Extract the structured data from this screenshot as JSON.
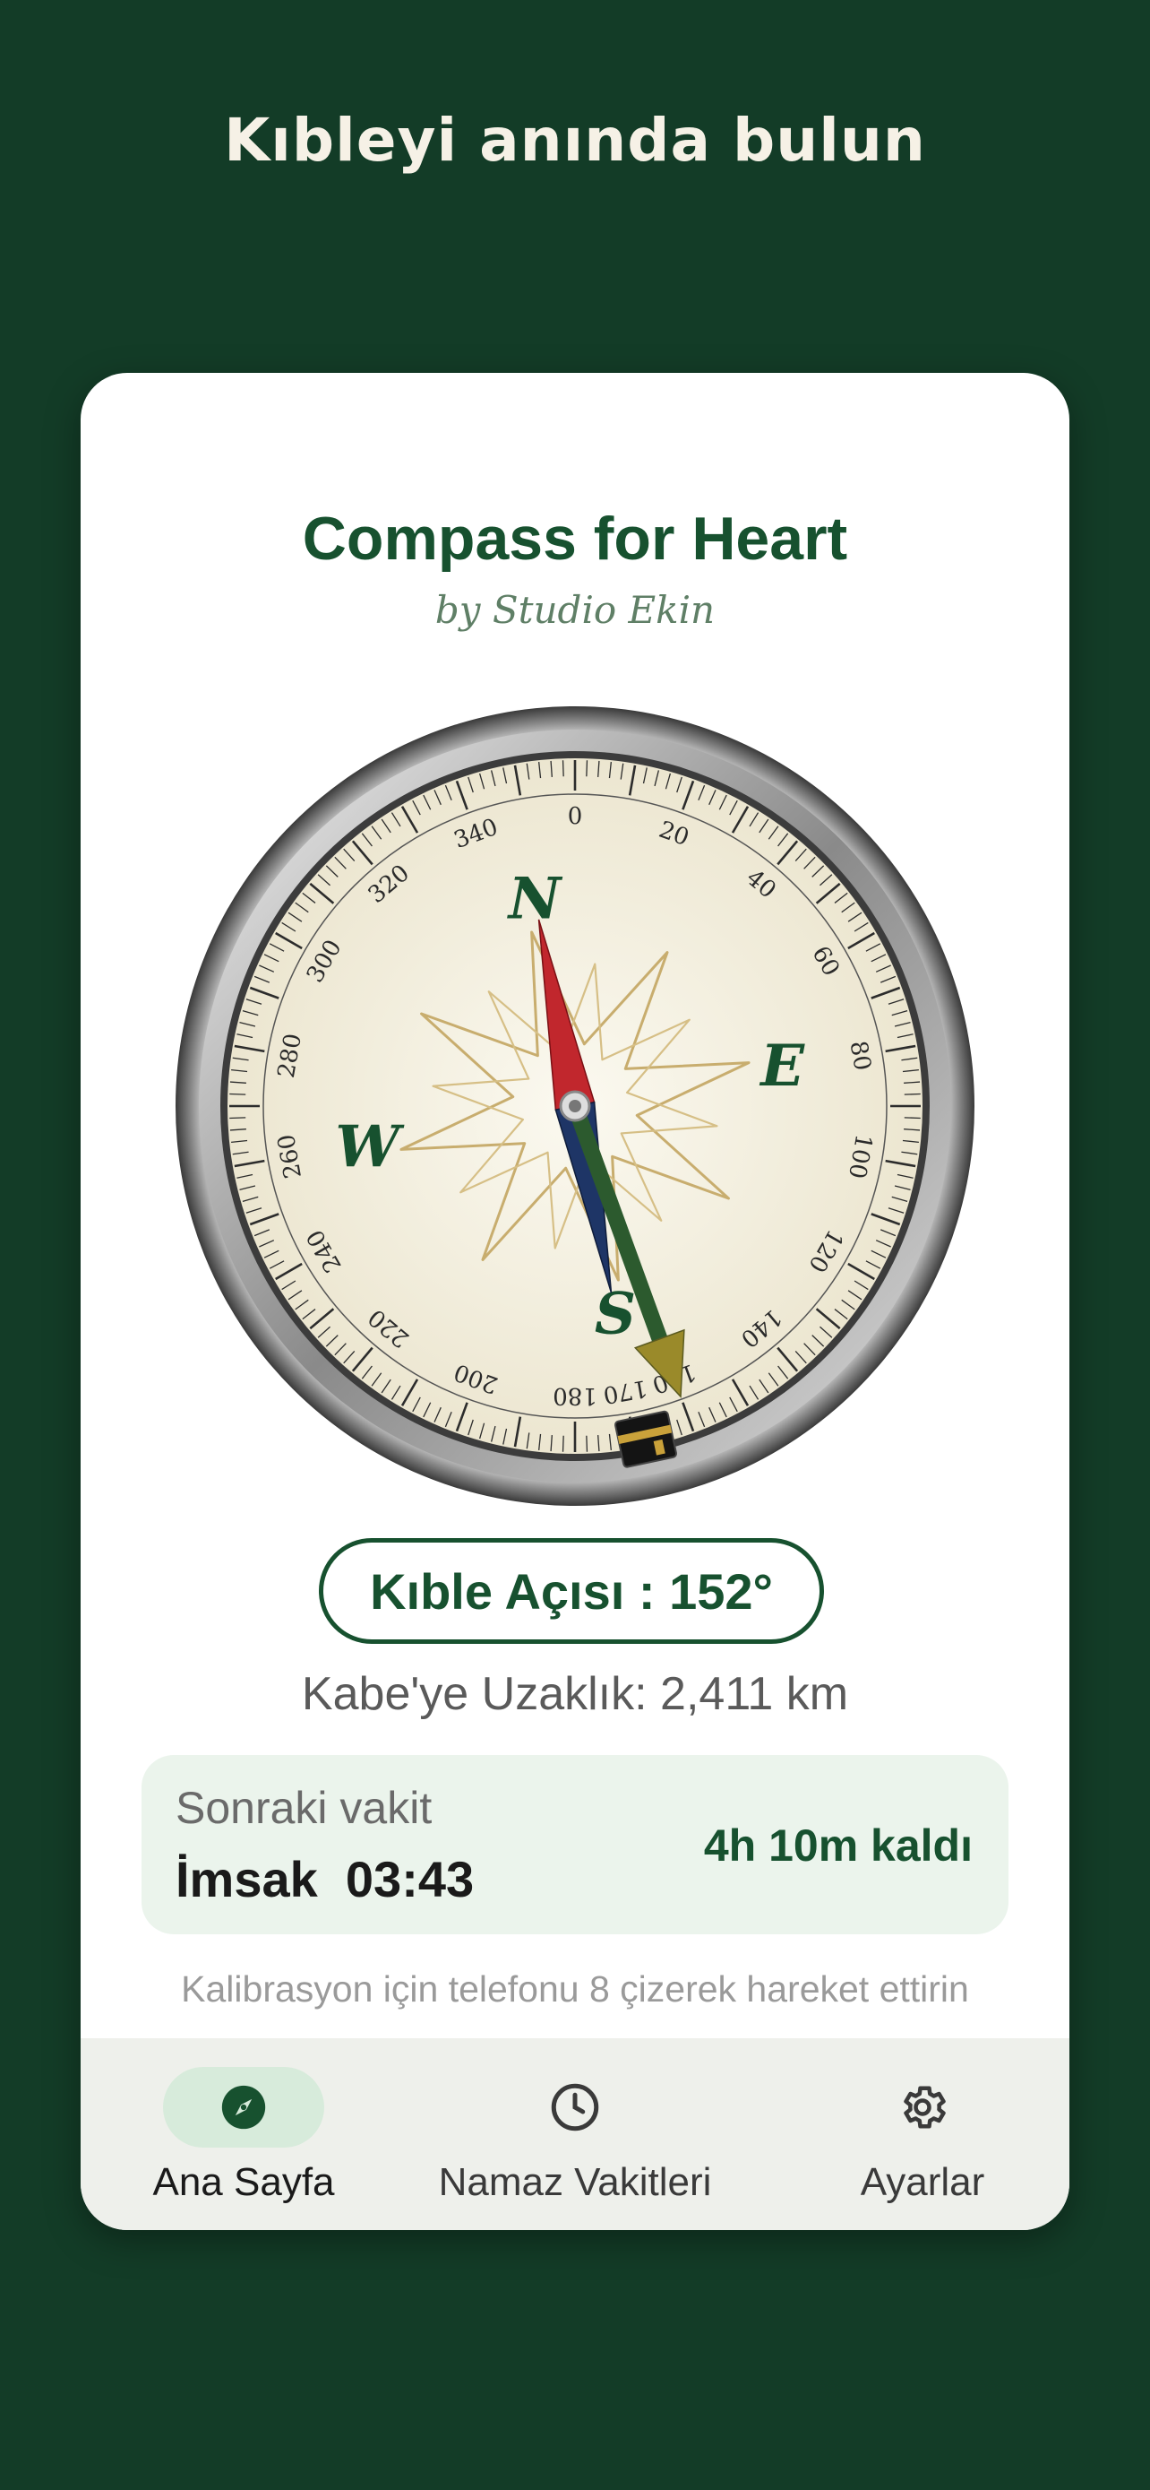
{
  "headline": "Kıbleyi anında bulun",
  "app": {
    "title": "Compass for Heart",
    "subtitle": "by Studio Ekin"
  },
  "compass": {
    "cardinals": {
      "north": "N",
      "east": "E",
      "south": "S",
      "west": "W"
    },
    "needle_heading_deg": 349,
    "qibla_pointer_deg": 160,
    "ticks": [
      "0",
      "20",
      "40",
      "60",
      "80",
      "100",
      "120",
      "140",
      "160",
      "170",
      "180",
      "200",
      "220",
      "240",
      "260",
      "280",
      "300",
      "320",
      "340"
    ],
    "colors": {
      "north": "#c1272d",
      "south": "#1e3566",
      "qibla": "#1d5a2c",
      "dial": "#f7f4e8",
      "bezel": "#9a9a9a"
    }
  },
  "qibla": {
    "angle_label": "Kıble Açısı : 152°",
    "distance_label": "Kabe'ye Uzaklık: 2,411 km"
  },
  "next_prayer": {
    "label": "Sonraki vakit",
    "name_time": "İmsak  03:43",
    "remaining": "4h 10m kaldı"
  },
  "calibration_hint": "Kalibrasyon için telefonu 8 çizerek hareket ettirin",
  "nav": {
    "items": [
      {
        "label": "Ana Sayfa",
        "icon": "compass-icon",
        "active": true
      },
      {
        "label": "Namaz Vakitleri",
        "icon": "clock-icon",
        "active": false
      },
      {
        "label": "Ayarlar",
        "icon": "gear-icon",
        "active": false
      }
    ]
  },
  "colors": {
    "brand": "#17512f",
    "background": "#133c27",
    "card": "#ebf4ec"
  }
}
